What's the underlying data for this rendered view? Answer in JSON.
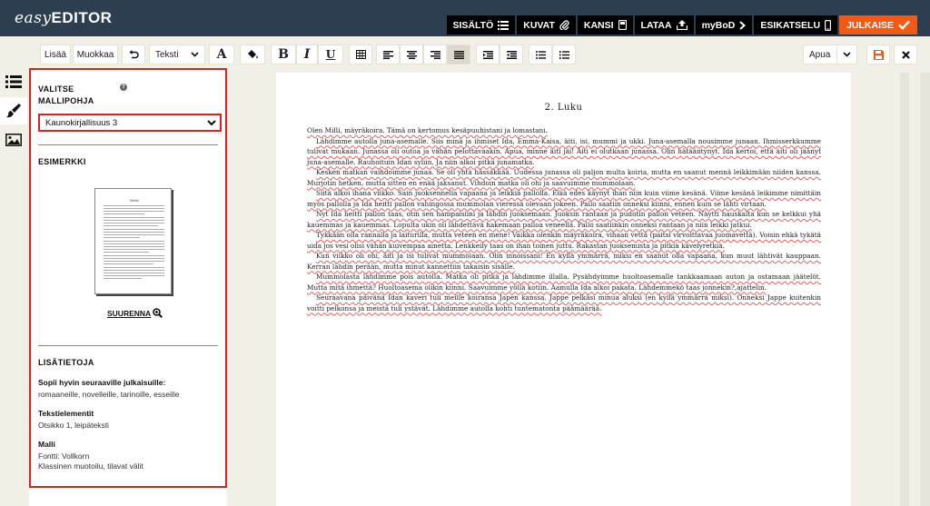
{
  "app": {
    "logo_prefix": "easy",
    "logo_main": "EDITOR"
  },
  "topnav": {
    "items": [
      {
        "label": "SISÄLTÖ",
        "icon": "list-icon"
      },
      {
        "label": "KUVAT",
        "icon": "paperclip-icon"
      },
      {
        "label": "KANSI",
        "icon": "book-icon"
      },
      {
        "label": "LATAA",
        "icon": "upload-icon"
      },
      {
        "label": "myBoD",
        "icon": "chevron-right-icon"
      },
      {
        "label": "ESIKATSELU",
        "icon": "phone-icon"
      },
      {
        "label": "JULKAISE",
        "icon": "checkmark-icon"
      }
    ]
  },
  "toolbar": {
    "add_label": "Lisää",
    "edit_label": "Muokkaa",
    "style_label": "Teksti",
    "font_icon_label": "A",
    "bold_label": "B",
    "italic_label": "I",
    "underline_label": "U",
    "help_label": "Apua"
  },
  "panel": {
    "select_heading": "VALITSE\nMALLIPOHJA",
    "select_value": "Kaunokirjallisuus 3",
    "examples_heading": "ESIMERKKI",
    "thumb_title": "Tittelisi",
    "zoom_label": "SUURENNA",
    "info_heading": "LISÄTIETOJA",
    "suitable_label": "Sopii hyvin seuraaville julkaisuille:",
    "suitable_value": "romaaneille, novelleille, tarinoille, esseille",
    "elements_label": "Tekstielementit",
    "elements_value": "Otsikko 1, leipäteksti",
    "template_label": "Malli",
    "template_value_1": "Fontti: Vollkorn",
    "template_value_2": "Klassinen muotoilu, tilavat välit"
  },
  "document": {
    "chapter_title": "2. Luku",
    "paragraphs": [
      "Olen Milli, mäyräkoira. Tämä on kertomus kesäpuuhistani ja lomastani.",
      "Lähdimme autolla juna-asemalle. Siis minä ja ihmiset Ida, Emma-Kaisa, äiti, isi, mummi ja ukki. Juna-asemalla nousimme junaan. Ihmisserkkumme tulivat mukaan. Junassa oli outoa ja vähän pelottavaakin. Apua, minne äiti jäi! Äiti ei olutkaan junassa. Olin hätääntynyt. Ida kertoi, että äiti oli jäänyt juna-asemalle. Rauhoituin Idan syliin. Ja niin alkoi pitkä junamatka.",
      "Kesken matkan vaihdoimme junaa. Se oli yhtä hässäkkää. Uudessa junassa oli paljon multa koiria, mutta en saanut mennä leikkimään niiden kanssa. Murjotin hetken, mutta sitten en enää jaksanut. Vihdoin matka oli ohi ja saavuimme mummolaan.",
      "Siitä alkoi ihana viikko. Sain juoksennella vapaana ja leikkiä pallolla. Eikä edes käynyt ihan niin kuin viime kesänä. Viime kesänä leikimme nimittäin myös pallolla ja Ida heitti pallon vahingossa mummolan vieressä olevaan jokeen. Pallo saatiin onneksi kiinni, ennen kuin se lähti virtaan.",
      "Nyt Ida heitti pallon taas, otin sen hampaisiini ja lähdin juoksemaan. Juoksin rantaan ja pudotin pallon veteen. Näytti hauskalta kun se kelkkui yhä kauemmas ja kauemmas. Lopulta ukin oli lähdettävä hakemaan palloa veneellä. Pallo saatiinkin onneksi rantaan ja niin leikki jatkui.",
      "Tykkään olla rannalla ja laiturilla, mutta veteen en mene! Vaikka olenkin mäyräkoira, vihaan vettä (paitsi virvoittavaa juomavettä). Voisin ehkä tykätä uida jos vesi olisi vähän kuivempaa ainetta. Lenkkeily taas on ihan toinen juttu. Rakastan juoksemista ja pitkiä kävelyretkiä.",
      "Kun viikko oli ohi, äiti ja isi tulivat mummolaan. Olin innoissani! En kyllä ymmärrä, miksi en saanut olla vapaana, kun muut lähtivät kauppaan. Kerran lähdin perään, mutta minut kannettiin takaisin sisälle.",
      "Mummolasta lähdimme pois autolla. Matka oli pitkä ja lähdimme illalla. Pysähdyimme huoltoasemalle tankkaamaan auton ja ostamaan jäätelöt. Mutta mitä ihmettä? Huoltoasema olikin kiinni. Saavuimme yöllä kotiin. Aamulla Ida alkoi pakata. Lähdemmekö taas jonnekin?,ajattelin.",
      "Seuraavana päivänä Idan kaveri tuli meille koiransa Japen kanssa. Jappe pelkäsi minua aluksi (en kyllä ymmärrä miksi). Onneksi Jappe kuitenkin voitti pelkonsa ja meistä tuli ystävät. Lähdimme autolla kohti tuntematonta päämäärää."
    ]
  }
}
